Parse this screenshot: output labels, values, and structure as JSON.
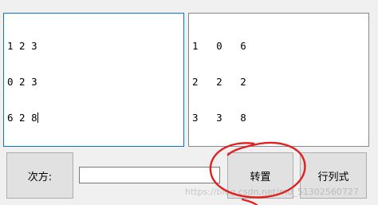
{
  "left_matrix": {
    "rows": [
      "1 2 3",
      "0 2 3",
      "6 2 8"
    ]
  },
  "right_matrix": {
    "rows": [
      "1   0   6",
      "2   2   2",
      "3   3   8"
    ]
  },
  "controls": {
    "power_label": "次方:",
    "power_value": "",
    "transpose_label": "转置",
    "determinant_label": "行列式"
  },
  "watermark": "https://blog.csdn.net/m0_51302560727",
  "colors": {
    "focus_border": "#0078d7",
    "annotation_red": "#e02020"
  }
}
